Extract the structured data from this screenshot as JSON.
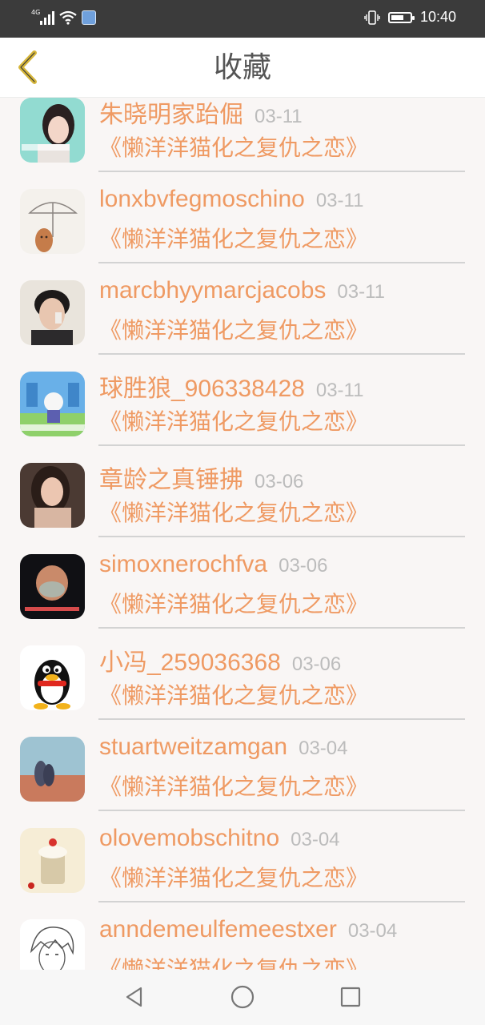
{
  "status_bar": {
    "network_label": "4G",
    "time": "10:40",
    "battery_level": 0.7,
    "icons": [
      "signal-icon",
      "wifi-icon",
      "app-notification-icon",
      "vibrate-icon",
      "battery-icon"
    ]
  },
  "header": {
    "back_icon": "chevron-left-icon",
    "title": "收藏"
  },
  "favorites": [
    {
      "name": "朱晓明家跆倔",
      "date": "03-11",
      "title": "《懒洋洋猫化之复仇之恋》"
    },
    {
      "name": "lonxbvfegmoschino",
      "date": "03-11",
      "title": "《懒洋洋猫化之复仇之恋》"
    },
    {
      "name": "marcbhyymarcjacobs",
      "date": "03-11",
      "title": "《懒洋洋猫化之复仇之恋》"
    },
    {
      "name": "球胜狼_906338428",
      "date": "03-11",
      "title": "《懒洋洋猫化之复仇之恋》"
    },
    {
      "name": "章龄之真锤拂",
      "date": "03-06",
      "title": "《懒洋洋猫化之复仇之恋》"
    },
    {
      "name": "simoxnerochfva",
      "date": "03-06",
      "title": "《懒洋洋猫化之复仇之恋》"
    },
    {
      "name": "小冯_259036368",
      "date": "03-06",
      "title": "《懒洋洋猫化之复仇之恋》"
    },
    {
      "name": "stuartweitzamgan",
      "date": "03-04",
      "title": "《懒洋洋猫化之复仇之恋》"
    },
    {
      "name": "olovemobschitno",
      "date": "03-04",
      "title": "《懒洋洋猫化之复仇之恋》"
    },
    {
      "name": "anndemeulfemeestxer",
      "date": "03-04",
      "title": "《懒洋洋猫化之复仇之恋》"
    }
  ],
  "nav_bar": {
    "icons": [
      "back-triangle-icon",
      "home-circle-icon",
      "recents-square-icon"
    ]
  },
  "colors": {
    "accent": "#ef9a63",
    "date_gray": "#bcbcbc",
    "title_gray": "#555555",
    "back_icon_yellow": "#d6b63a",
    "status_bar_bg": "#3b3b3b"
  }
}
